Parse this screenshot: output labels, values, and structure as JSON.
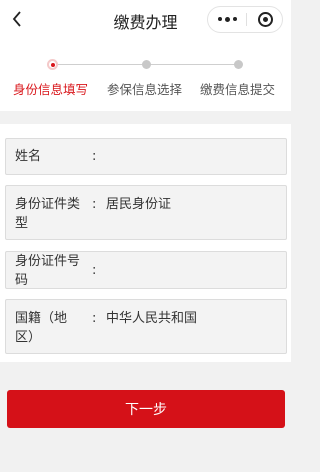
{
  "navbar": {
    "title": "缴费办理"
  },
  "steps": [
    {
      "label": "身份信息填写",
      "active": true
    },
    {
      "label": "参保信息选择",
      "active": false
    },
    {
      "label": "缴费信息提交",
      "active": false
    }
  ],
  "form": {
    "colon": ":",
    "rows": [
      {
        "label": "姓名",
        "value": ""
      },
      {
        "label": "身份证件类型",
        "value": "居民身份证"
      },
      {
        "label": "身份证件号码",
        "value": ""
      },
      {
        "label": "国籍（地区）",
        "value": "中华人民共和国"
      }
    ]
  },
  "next_button": {
    "label": "下一步"
  },
  "colors": {
    "accent": "#d51118",
    "background": "#f1f1f1"
  }
}
